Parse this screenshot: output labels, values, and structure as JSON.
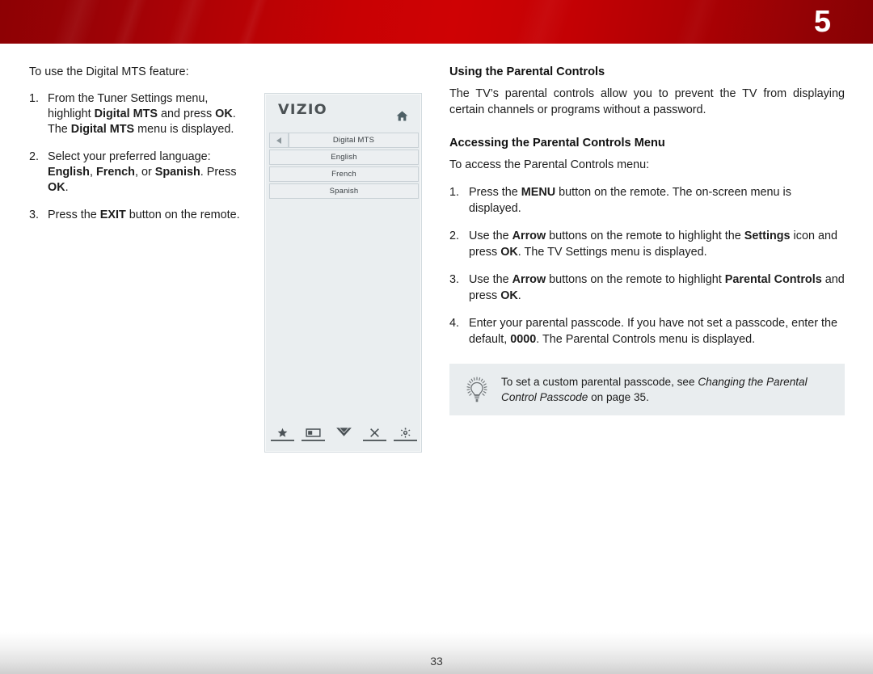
{
  "header": {
    "chapter_number": "5",
    "band_color_left": "#8d0104",
    "band_color_mid": "#cf0204",
    "band_color_right": "#870104"
  },
  "left_column": {
    "lead": "To use the Digital MTS feature:",
    "steps": [
      {
        "marker": "1.",
        "parts": [
          {
            "text": "From the Tuner Settings menu, highlight ",
            "style": "normal"
          },
          {
            "text": "Digital MTS",
            "style": "bold"
          },
          {
            "text": " and press ",
            "style": "normal"
          },
          {
            "text": "OK",
            "style": "bold"
          },
          {
            "text": ". The ",
            "style": "normal"
          },
          {
            "text": "Digital MTS",
            "style": "bold"
          },
          {
            "text": " menu is displayed.",
            "style": "normal"
          }
        ]
      },
      {
        "marker": "2.",
        "parts": [
          {
            "text": "Select your preferred language: ",
            "style": "normal"
          },
          {
            "text": "English",
            "style": "bold"
          },
          {
            "text": ", ",
            "style": "normal"
          },
          {
            "text": "French",
            "style": "bold"
          },
          {
            "text": ", or ",
            "style": "normal"
          },
          {
            "text": "Spanish",
            "style": "bold"
          },
          {
            "text": ". Press ",
            "style": "normal"
          },
          {
            "text": "OK",
            "style": "bold"
          },
          {
            "text": ".",
            "style": "normal"
          }
        ]
      },
      {
        "marker": "3.",
        "parts": [
          {
            "text": "Press the ",
            "style": "normal"
          },
          {
            "text": "EXIT",
            "style": "bold"
          },
          {
            "text": " button on the remote.",
            "style": "normal"
          }
        ]
      }
    ]
  },
  "tv_mock": {
    "brand": "VIZIO",
    "home_icon": "home-icon",
    "back_icon": "back-arrow-icon",
    "menu_title": "Digital MTS",
    "options": [
      "English",
      "French",
      "Spanish"
    ],
    "bottom_icons": [
      {
        "name": "star-icon",
        "glyph": "star",
        "underline": true
      },
      {
        "name": "picture-mode-icon",
        "glyph": "screen",
        "underline": true
      },
      {
        "name": "chevron-down-icon",
        "glyph": "chevron-down",
        "underline": false
      },
      {
        "name": "close-icon",
        "glyph": "x",
        "underline": true
      },
      {
        "name": "gear-icon",
        "glyph": "gear",
        "underline": true
      }
    ]
  },
  "right_column": {
    "heading_1": "Using the Parental Controls",
    "paragraph_1": "The TV’s parental controls allow you to prevent the TV from displaying certain channels or programs without a password.",
    "heading_2": "Accessing the Parental Controls Menu",
    "lead_2": "To access the Parental Controls menu:",
    "steps": [
      {
        "marker": "1.",
        "parts": [
          {
            "text": "Press the ",
            "style": "normal"
          },
          {
            "text": "MENU",
            "style": "bold"
          },
          {
            "text": " button on the remote. The on-screen menu is displayed.",
            "style": "normal"
          }
        ]
      },
      {
        "marker": "2.",
        "parts": [
          {
            "text": "Use the ",
            "style": "normal"
          },
          {
            "text": "Arrow",
            "style": "bold"
          },
          {
            "text": " buttons on the remote to highlight the ",
            "style": "normal"
          },
          {
            "text": "Settings",
            "style": "bold"
          },
          {
            "text": " icon and press ",
            "style": "normal"
          },
          {
            "text": "OK",
            "style": "bold"
          },
          {
            "text": ". The TV Settings menu is displayed.",
            "style": "normal"
          }
        ]
      },
      {
        "marker": "3.",
        "parts": [
          {
            "text": "Use the ",
            "style": "normal"
          },
          {
            "text": "Arrow",
            "style": "bold"
          },
          {
            "text": " buttons on the remote to highlight ",
            "style": "normal"
          },
          {
            "text": "Parental Controls",
            "style": "bold"
          },
          {
            "text": " and press ",
            "style": "normal"
          },
          {
            "text": "OK",
            "style": "bold"
          },
          {
            "text": ".",
            "style": "normal"
          }
        ]
      },
      {
        "marker": "4.",
        "parts": [
          {
            "text": "Enter your parental passcode. If you have not set a passcode, enter the default, ",
            "style": "normal"
          },
          {
            "text": "0000",
            "style": "bold"
          },
          {
            "text": ". The Parental Controls menu is displayed.",
            "style": "normal"
          }
        ]
      }
    ],
    "tip": {
      "icon": "lightbulb-icon",
      "parts": [
        {
          "text": "To set a custom parental passcode, see ",
          "style": "normal"
        },
        {
          "text": "Changing the Parental Control Passcode",
          "style": "italic"
        },
        {
          "text": " on page 35.",
          "style": "normal"
        }
      ]
    }
  },
  "footer": {
    "page_number": "33"
  }
}
